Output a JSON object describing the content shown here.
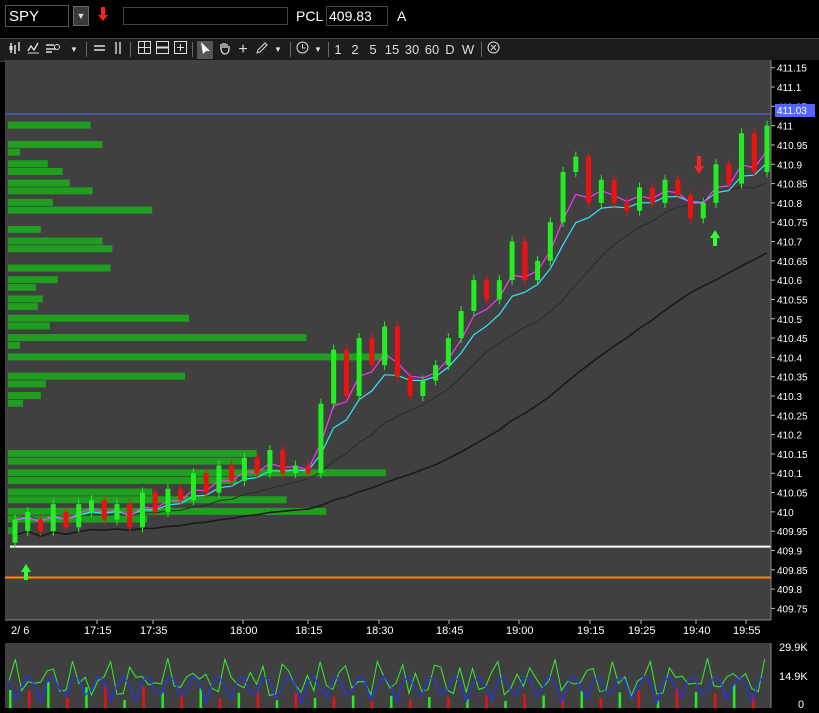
{
  "topbar": {
    "symbol": "SPY",
    "pcl_label": "PCL",
    "pcl_value": "409.83",
    "account_label": "A"
  },
  "toolbar": {
    "intervals": [
      "1",
      "2",
      "5",
      "15",
      "30",
      "60",
      "D",
      "W"
    ]
  },
  "price_axis": {
    "ticks": [
      "411.15",
      "411.1",
      "411.05",
      "411",
      "410.95",
      "410.9",
      "410.85",
      "410.8",
      "410.75",
      "410.7",
      "410.65",
      "410.6",
      "410.55",
      "410.5",
      "410.45",
      "410.4",
      "410.35",
      "410.3",
      "410.25",
      "410.2",
      "410.15",
      "410.1",
      "410.05",
      "410",
      "409.95",
      "409.9",
      "409.85",
      "409.8",
      "409.75"
    ],
    "last_price": "411.03"
  },
  "time_axis": {
    "date_label": "2/ 6",
    "ticks": [
      "17:15",
      "17:35",
      "18:00",
      "18:15",
      "18:30",
      "18:45",
      "19:00",
      "19:15",
      "19:25",
      "19:40",
      "19:55"
    ]
  },
  "volume_axis": {
    "ticks": [
      "29.9K",
      "14.9K",
      "0"
    ]
  },
  "colors": {
    "background": "#404040",
    "bull_candle": "#22ee22",
    "bear_candle": "#ee1111",
    "volume_profile": "#1f9e1f",
    "ema_fast": "#ff33ff",
    "ema_mid": "#33e6ff",
    "ma_slow": "#111111",
    "pcl_line": "#ff8800",
    "support_line": "#ffffff",
    "resistance_line": "#5566ff"
  },
  "chart_data": {
    "type": "candlestick",
    "ylim": [
      409.72,
      411.17
    ],
    "x_ticks": [
      "17:15",
      "17:35",
      "18:00",
      "18:15",
      "18:30",
      "18:45",
      "19:00",
      "19:15",
      "19:25",
      "19:40",
      "19:55"
    ],
    "candles": [
      [
        409.92,
        409.98
      ],
      [
        409.95,
        410.0
      ],
      [
        409.98,
        409.95
      ],
      [
        409.95,
        410.02
      ],
      [
        410.0,
        409.96
      ],
      [
        409.96,
        410.02
      ],
      [
        410.0,
        410.03
      ],
      [
        410.03,
        409.98
      ],
      [
        409.98,
        410.02
      ],
      [
        410.02,
        409.96
      ],
      [
        409.96,
        410.05
      ],
      [
        410.05,
        410.0
      ],
      [
        410.0,
        410.06
      ],
      [
        410.06,
        410.03
      ],
      [
        410.03,
        410.1
      ],
      [
        410.1,
        410.05
      ],
      [
        410.05,
        410.12
      ],
      [
        410.12,
        410.08
      ],
      [
        410.08,
        410.14
      ],
      [
        410.14,
        410.1
      ],
      [
        410.1,
        410.16
      ],
      [
        410.16,
        410.1
      ],
      [
        410.1,
        410.12
      ],
      [
        410.12,
        410.1
      ],
      [
        410.1,
        410.28
      ],
      [
        410.28,
        410.42
      ],
      [
        410.42,
        410.3
      ],
      [
        410.3,
        410.45
      ],
      [
        410.45,
        410.38
      ],
      [
        410.38,
        410.48
      ],
      [
        410.48,
        410.35
      ],
      [
        410.35,
        410.3
      ],
      [
        410.3,
        410.34
      ],
      [
        410.34,
        410.38
      ],
      [
        410.38,
        410.45
      ],
      [
        410.45,
        410.52
      ],
      [
        410.52,
        410.6
      ],
      [
        410.6,
        410.55
      ],
      [
        410.55,
        410.6
      ],
      [
        410.6,
        410.7
      ],
      [
        410.7,
        410.6
      ],
      [
        410.6,
        410.65
      ],
      [
        410.65,
        410.75
      ],
      [
        410.75,
        410.88
      ],
      [
        410.88,
        410.92
      ],
      [
        410.92,
        410.8
      ],
      [
        410.8,
        410.86
      ],
      [
        410.86,
        410.8
      ],
      [
        410.8,
        410.78
      ],
      [
        410.78,
        410.84
      ],
      [
        410.84,
        410.8
      ],
      [
        410.8,
        410.86
      ],
      [
        410.86,
        410.82
      ],
      [
        410.82,
        410.76
      ],
      [
        410.76,
        410.8
      ],
      [
        410.8,
        410.9
      ],
      [
        410.9,
        410.85
      ],
      [
        410.85,
        410.98
      ],
      [
        410.98,
        410.88
      ],
      [
        410.88,
        411.0
      ]
    ],
    "volume_profile": [
      {
        "price": 411.0,
        "size": 83
      },
      {
        "price": 410.95,
        "size": 95
      },
      {
        "price": 410.93,
        "size": 12
      },
      {
        "price": 410.9,
        "size": 40
      },
      {
        "price": 410.88,
        "size": 55
      },
      {
        "price": 410.85,
        "size": 62
      },
      {
        "price": 410.83,
        "size": 85
      },
      {
        "price": 410.8,
        "size": 45
      },
      {
        "price": 410.78,
        "size": 145
      },
      {
        "price": 410.73,
        "size": 33
      },
      {
        "price": 410.7,
        "size": 95
      },
      {
        "price": 410.68,
        "size": 105
      },
      {
        "price": 410.63,
        "size": 103
      },
      {
        "price": 410.6,
        "size": 50
      },
      {
        "price": 410.58,
        "size": 28
      },
      {
        "price": 410.55,
        "size": 35
      },
      {
        "price": 410.53,
        "size": 30
      },
      {
        "price": 410.5,
        "size": 182
      },
      {
        "price": 410.48,
        "size": 42
      },
      {
        "price": 410.45,
        "size": 300
      },
      {
        "price": 410.43,
        "size": 12
      },
      {
        "price": 410.4,
        "size": 382
      },
      {
        "price": 410.35,
        "size": 178
      },
      {
        "price": 410.33,
        "size": 38
      },
      {
        "price": 410.3,
        "size": 33
      },
      {
        "price": 410.28,
        "size": 15
      },
      {
        "price": 410.15,
        "size": 250
      },
      {
        "price": 410.13,
        "size": 240
      },
      {
        "price": 410.1,
        "size": 380
      },
      {
        "price": 410.08,
        "size": 230
      },
      {
        "price": 410.05,
        "size": 145
      },
      {
        "price": 410.03,
        "size": 280
      },
      {
        "price": 410.0,
        "size": 320
      },
      {
        "price": 409.98,
        "size": 140
      },
      {
        "price": 409.95,
        "size": 8
      }
    ],
    "levels": {
      "resistance": 411.03,
      "support": 409.91,
      "pcl": 409.83
    }
  }
}
